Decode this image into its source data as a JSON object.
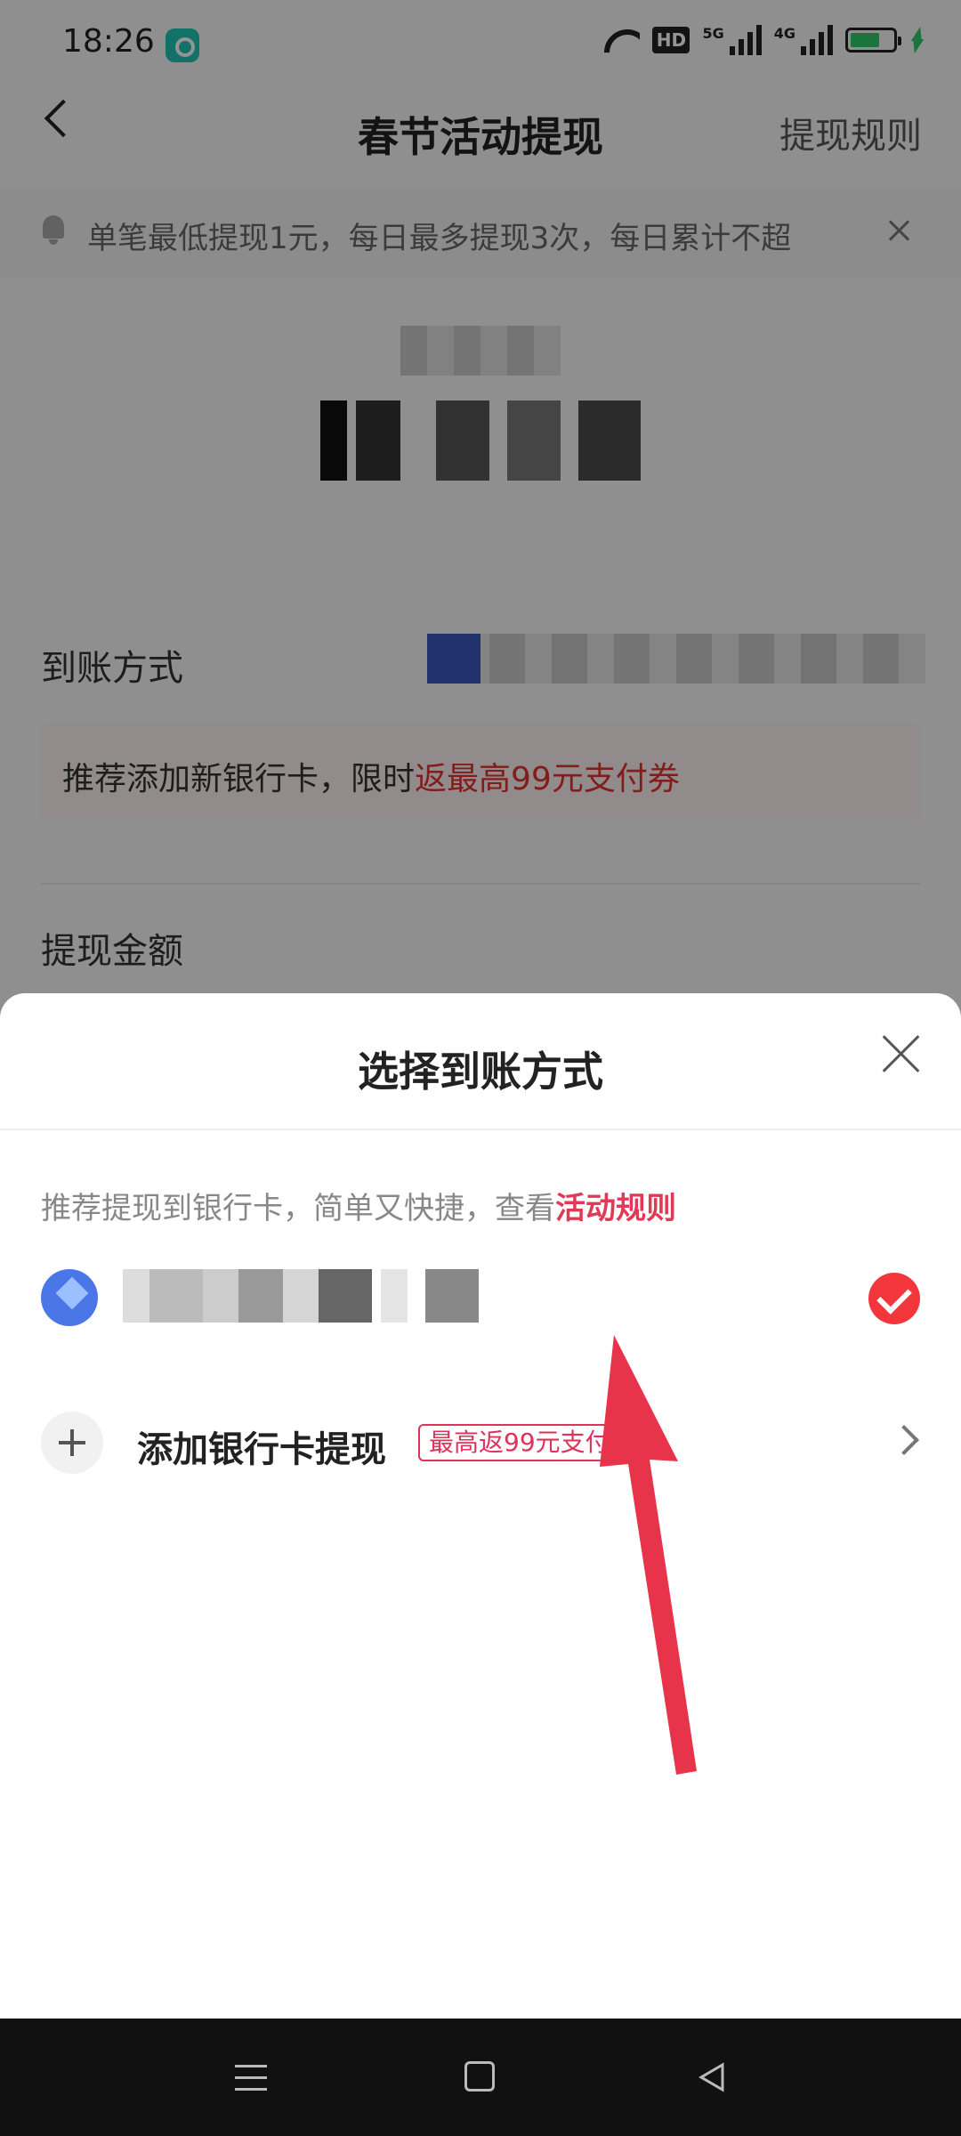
{
  "status_bar": {
    "time": "18:26",
    "hd_label": "HD",
    "sig1_label": "5G",
    "sig2_label": "4G"
  },
  "header": {
    "title": "春节活动提现",
    "action_label": "提现规则"
  },
  "notice": {
    "text": "单笔最低提现1元，每日最多提现3次，每日累计不超"
  },
  "form": {
    "method_label": "到账方式",
    "promo_text": "推荐添加新银行卡，限时",
    "promo_highlight": "返最高99元支付券",
    "amount_label": "提现金额"
  },
  "sheet": {
    "title": "选择到账方式",
    "hint_text": "推荐提现到银行卡，简单又快捷，查看",
    "hint_link": "活动规则",
    "add_card_label": "添加银行卡提现",
    "add_card_badge": "最高返99元支付券"
  },
  "colors": {
    "accent_red": "#f2363c",
    "link_pink": "#e03a56",
    "annotation_arrow": "#e8344a"
  }
}
